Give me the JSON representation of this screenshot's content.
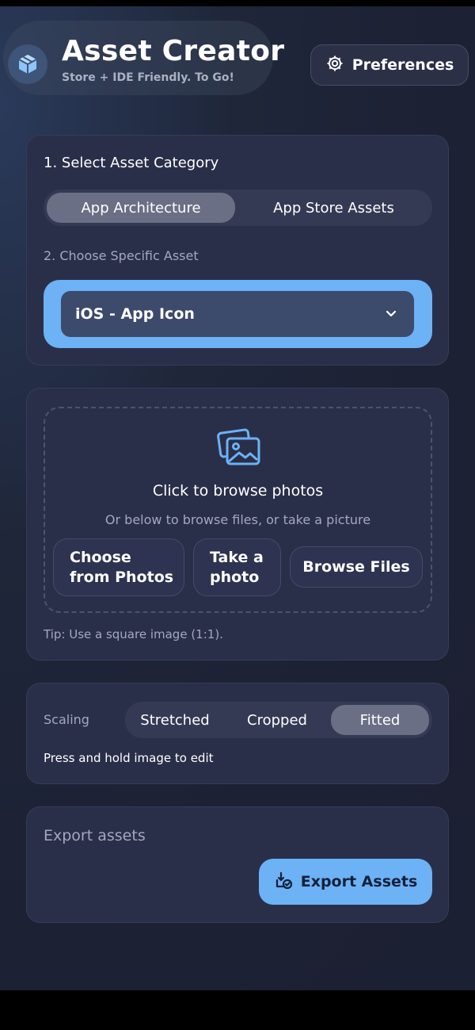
{
  "header": {
    "title": "Asset Creator",
    "subtitle": "Store + IDE Friendly. To Go!",
    "logo_icon": "cube-icon",
    "preferences_label": "Preferences",
    "preferences_icon": "gear-icon"
  },
  "category": {
    "heading": "1. Select Asset Category",
    "tabs": [
      {
        "label": "App Architecture",
        "active": true
      },
      {
        "label": "App Store Assets",
        "active": false
      }
    ],
    "specific_heading": "2. Choose Specific Asset",
    "selected_asset": "iOS - App Icon",
    "select_icon": "chevron-down-icon"
  },
  "upload": {
    "icon": "photos-icon",
    "title": "Click to browse photos",
    "subtitle": "Or below to browse files, or take a picture",
    "buttons": {
      "choose_photos": "Choose\nfrom Photos",
      "take_photo": "Take a\nphoto",
      "browse_files": "Browse Files"
    },
    "tip": "Tip: Use a square image (1:1)."
  },
  "scaling": {
    "label": "Scaling",
    "options": [
      {
        "label": "Stretched",
        "active": false
      },
      {
        "label": "Cropped",
        "active": false
      },
      {
        "label": "Fitted",
        "active": true
      }
    ],
    "hint": "Press and hold image to edit"
  },
  "export": {
    "heading": "Export assets",
    "button_label": "Export Assets",
    "button_icon": "export-icon"
  },
  "colors": {
    "accent": "#6cb2f5",
    "card": "#2a2f49",
    "background": "#1c2133"
  }
}
